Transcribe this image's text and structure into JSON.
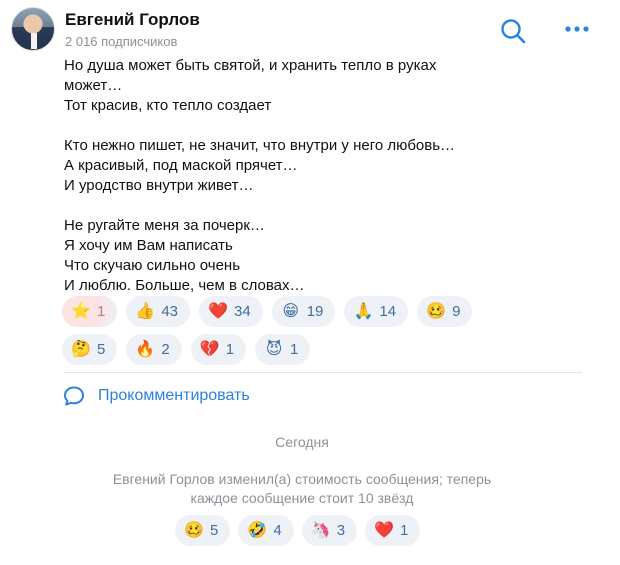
{
  "header": {
    "title": "Евгений Горлов",
    "subscribers": "2 016 подписчиков"
  },
  "post": {
    "text": "Но душа может быть святой, и хранить тепло в руках\nможет…\nТот красив, кто тепло создает\n\nКто нежно пишет, не значит, что внутри у него любовь…\nА красивый, под маской прячет…\nИ уродство внутри живет…\n\nНе ругайте меня за почерк…\nЯ хочу им Вам написать\nЧто скучаю сильно очень\nИ люблю.  Больше, чем в словах…"
  },
  "reactions": {
    "row1": [
      {
        "emoji": "⭐",
        "icon": "star-icon",
        "count": "1",
        "active": true
      },
      {
        "emoji": "👍",
        "icon": "thumbs-up-icon",
        "count": "43"
      },
      {
        "emoji": "❤️",
        "icon": "heart-icon",
        "count": "34"
      },
      {
        "emoji": "😁",
        "icon": "grin-icon",
        "count": "19"
      },
      {
        "emoji": "🙏",
        "icon": "pray-icon",
        "count": "14"
      },
      {
        "emoji": "🥴",
        "icon": "woozy-face-icon",
        "count": "9"
      }
    ],
    "row2": [
      {
        "emoji": "🤔",
        "icon": "thinking-face-icon",
        "count": "5"
      },
      {
        "emoji": "🔥",
        "icon": "fire-icon",
        "count": "2"
      },
      {
        "emoji": "💔",
        "icon": "broken-heart-icon",
        "count": "1"
      },
      {
        "emoji": "😈",
        "icon": "devil-icon",
        "count": "1"
      }
    ]
  },
  "comment": {
    "label": "Прокомментировать"
  },
  "day_separator": "Сегодня",
  "service_message": "Евгений Горлов изменил(а) стоимость сообщения; теперь\nкаждое сообщение стоит 10 звёзд",
  "service_reactions": [
    {
      "emoji": "🥴",
      "icon": "woozy-face-icon",
      "count": "5"
    },
    {
      "emoji": "🤣",
      "icon": "rofl-icon",
      "count": "4"
    },
    {
      "emoji": "🦄",
      "icon": "unicorn-icon",
      "count": "3"
    },
    {
      "emoji": "❤️",
      "icon": "heart-icon",
      "count": "1"
    }
  ],
  "colors": {
    "accent": "#2d81e0",
    "chip_bg": "#eef1f5",
    "muted": "#8c9199"
  }
}
